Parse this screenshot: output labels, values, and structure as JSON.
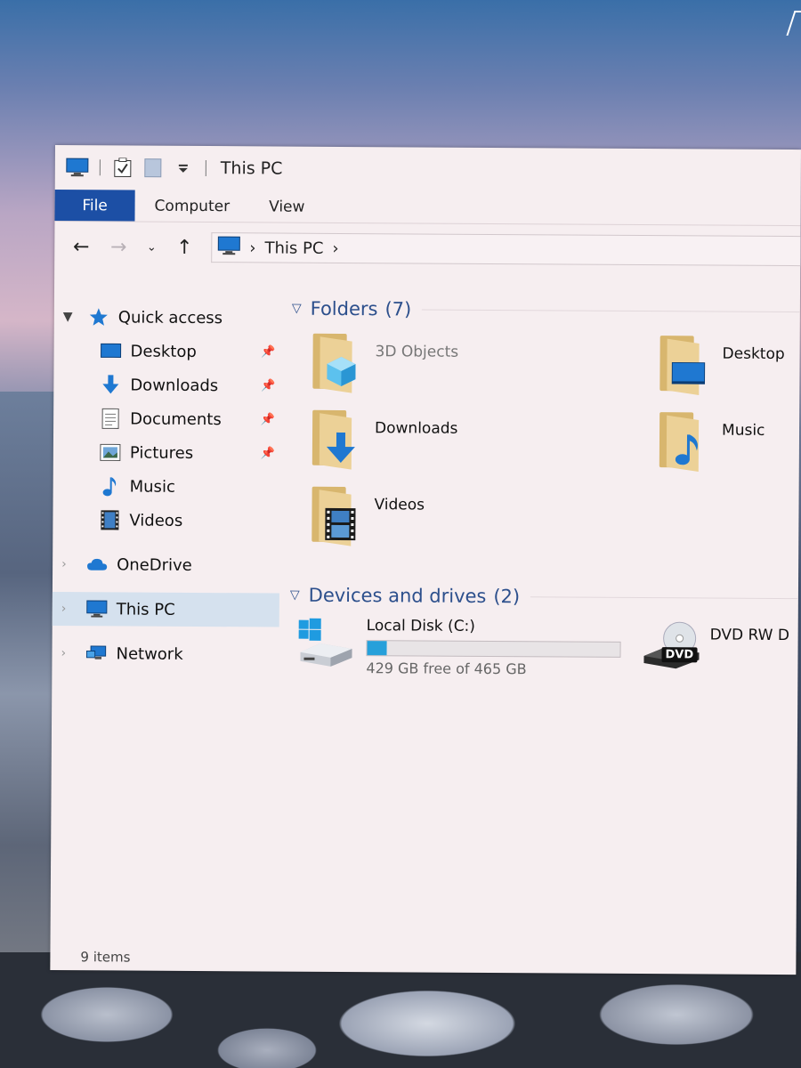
{
  "window": {
    "title": "This PC",
    "quick_access_icons": [
      "this-pc-icon",
      "properties-check-icon",
      "new-folder-icon",
      "customize-dropdown-icon"
    ]
  },
  "ribbon": {
    "tabs": [
      {
        "label": "File",
        "active": true
      },
      {
        "label": "Computer"
      },
      {
        "label": "View"
      }
    ]
  },
  "navigation": {
    "back": "←",
    "forward": "→",
    "recent": "⌄",
    "up": "↑",
    "breadcrumb": [
      "This PC"
    ]
  },
  "sidebar": {
    "quick_access": {
      "label": "Quick access",
      "items": [
        {
          "label": "Desktop",
          "icon": "desktop-icon",
          "pinned": true
        },
        {
          "label": "Downloads",
          "icon": "downloads-icon",
          "pinned": true
        },
        {
          "label": "Documents",
          "icon": "documents-icon",
          "pinned": true
        },
        {
          "label": "Pictures",
          "icon": "pictures-icon",
          "pinned": true
        },
        {
          "label": "Music",
          "icon": "music-icon",
          "pinned": false
        },
        {
          "label": "Videos",
          "icon": "videos-icon",
          "pinned": false
        }
      ]
    },
    "onedrive": {
      "label": "OneDrive"
    },
    "this_pc": {
      "label": "This PC"
    },
    "network": {
      "label": "Network"
    }
  },
  "content": {
    "folders_group": {
      "label": "Folders",
      "count": "(7)"
    },
    "folders": [
      {
        "name": "3D Objects",
        "emblem": "3d-objects-icon"
      },
      {
        "name": "Desktop",
        "emblem": "desktop-icon"
      },
      {
        "name": "Downloads",
        "emblem": "downloads-icon"
      },
      {
        "name": "Music",
        "emblem": "music-icon"
      },
      {
        "name": "Videos",
        "emblem": "videos-icon"
      }
    ],
    "devices_group": {
      "label": "Devices and drives",
      "count": "(2)"
    },
    "drives": [
      {
        "name": "Local Disk (C:)",
        "free_text": "429 GB free of 465 GB",
        "used_fraction": 0.077
      },
      {
        "name": "DVD RW D",
        "badge": "DVD"
      }
    ]
  },
  "status": {
    "items_text": "9 items"
  },
  "colors": {
    "file_tab": "#1c4fa5",
    "accent_blue": "#1f78d1",
    "group_header": "#2c4f8c",
    "drive_bar": "#26a0da",
    "selected_bg": "#d5e1ee"
  }
}
